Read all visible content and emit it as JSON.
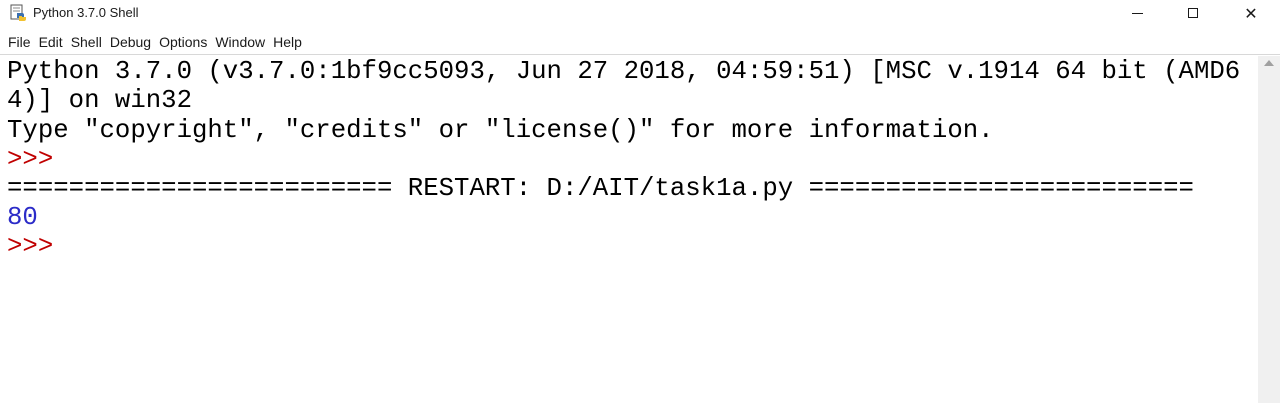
{
  "window": {
    "title": "Python 3.7.0 Shell",
    "controls": {
      "minimize": "minimize",
      "maximize": "maximize",
      "close": "✕"
    }
  },
  "menu": {
    "items": [
      "File",
      "Edit",
      "Shell",
      "Debug",
      "Options",
      "Window",
      "Help"
    ]
  },
  "shell": {
    "lines": [
      {
        "text": "Python 3.7.0 (v3.7.0:1bf9cc5093, Jun 27 2018, 04:59:51) [MSC v.1914 64 bit (AMD6",
        "kind": "text"
      },
      {
        "text": "4)] on win32",
        "kind": "text"
      },
      {
        "text": "Type \"copyright\", \"credits\" or \"license()\" for more information.",
        "kind": "text"
      },
      {
        "text": ">>>",
        "kind": "prompt"
      },
      {
        "text": "========================= RESTART: D:/AIT/task1a.py =========================",
        "kind": "text"
      },
      {
        "text": "80",
        "kind": "output"
      },
      {
        "text": ">>>",
        "kind": "prompt"
      }
    ]
  },
  "colors": {
    "prompt": "#c00000",
    "output": "#2b2bc8",
    "text": "#000000"
  },
  "icons": {
    "app": "idle-python-icon",
    "scroll_up": "scroll-up-arrow-icon"
  }
}
